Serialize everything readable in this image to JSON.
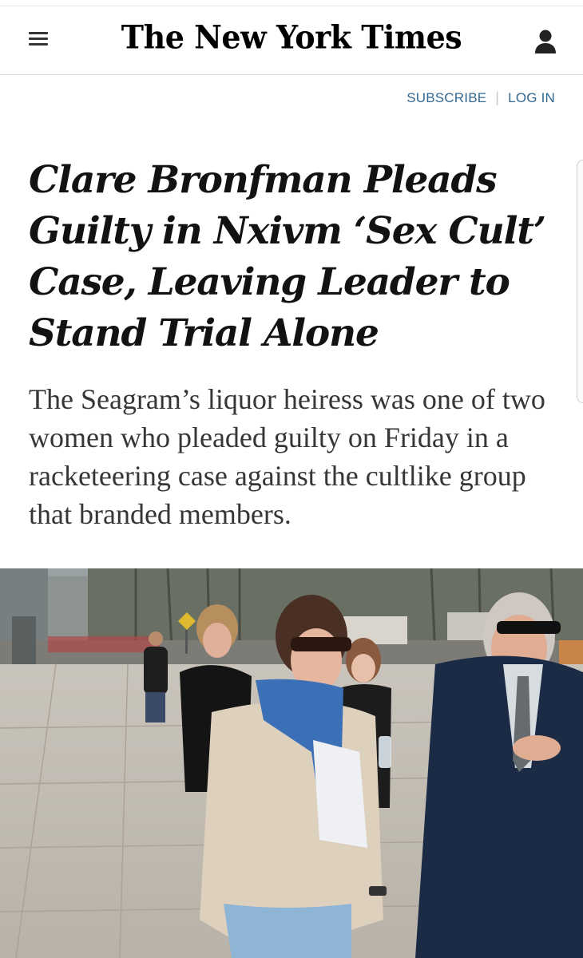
{
  "header": {
    "logo": "The New York Times",
    "menu_icon": "hamburger-menu-icon",
    "account_icon": "user-account-icon"
  },
  "account": {
    "subscribe": "SUBSCRIBE",
    "separator": "|",
    "login": "LOG IN"
  },
  "article": {
    "headline": "Clare Bronfman Pleads Guilty in Nxivm ‘Sex Cult’ Case, Leaving Leader to Stand Trial Alone",
    "summary": "The Seagram’s liquor heiress was one of two women who pleaded guilty on Friday in a racketeering case against the cultlike group that branded members."
  },
  "photo": {
    "road_sign": "icon-diamond-sign"
  },
  "colors": {
    "link": "#326891",
    "headline": "#121212",
    "summary": "#363636",
    "divider": "#dcdcdc"
  }
}
